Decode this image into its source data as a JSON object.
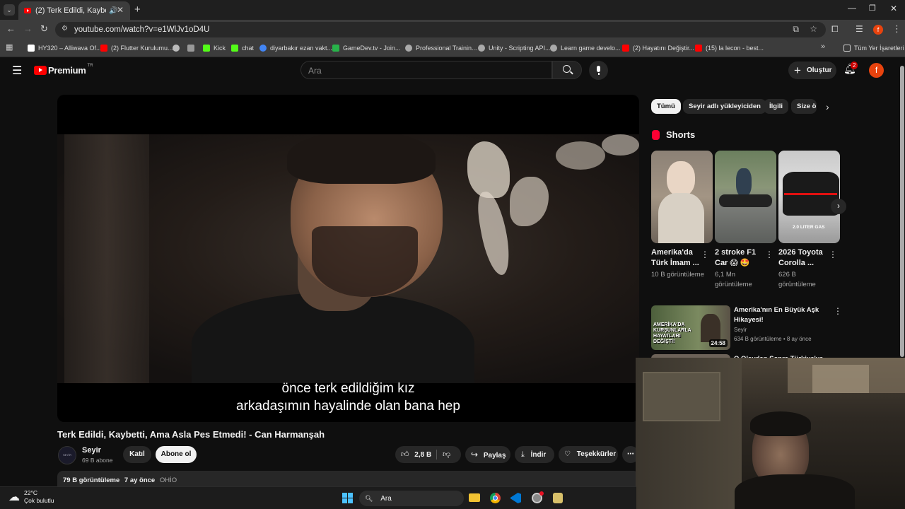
{
  "browser": {
    "tab_title": "(2) Terk Edildi, Kaybetti, Ama Asla Pes Etmedi! - Can Harmanşah",
    "tab_title_visible": "(2) Terk Edildi, Kaybetti, Am",
    "url": "youtube.com/watch?v=e1WlJv1oD4U",
    "profile_initial": "f",
    "bookmarks": [
      {
        "label": "HY320 – Alliwava Of...",
        "color": "#ffffff"
      },
      {
        "label": "(2) Flutter Kurulumu...",
        "color": "#ff0000"
      },
      {
        "label": "",
        "color": "#cccccc"
      },
      {
        "label": "",
        "color": "#cccccc"
      },
      {
        "label": "Kick",
        "color": "#53fc18"
      },
      {
        "label": "chat",
        "color": "#53fc18"
      },
      {
        "label": "diyarbakır ezan vakt...",
        "color": "#4285f4"
      },
      {
        "label": "GameDev.tv - Join...",
        "color": "#28b34a"
      },
      {
        "label": "Professional Trainin...",
        "color": "#cccccc"
      },
      {
        "label": "Unity - Scripting API...",
        "color": "#cccccc"
      },
      {
        "label": "Learn game develo...",
        "color": "#cccccc"
      },
      {
        "label": "(2) Hayatını Değiştir...",
        "color": "#ff0000"
      },
      {
        "label": "(15) la lecon - best...",
        "color": "#ff0000"
      }
    ],
    "bookmarks_all": "Tüm Yer İşaretleri"
  },
  "youtube": {
    "logo_text": "Premium",
    "logo_region": "TR",
    "search_placeholder": "Ara",
    "create_label": "Oluştur",
    "notif_count": "2",
    "avatar_initial": "f",
    "video": {
      "caption_line1": "önce terk edildiğim kız",
      "caption_line2": "arkadaşımın hayalinde olan bana hep",
      "title": "Terk Edildi, Kaybetti, Ama Asla Pes Etmedi! - Can Harmanşah",
      "channel": "Seyir",
      "subscribers": "69 B abone",
      "join": "Katıl",
      "subscribe": "Abone ol",
      "likes": "2,8 B",
      "share": "Paylaş",
      "download": "İndir",
      "thanks": "Teşekkürler",
      "views": "79 B görüntüleme",
      "age": "7 ay önce",
      "tag": "OHİO",
      "channel_avatar_text": "SEYİR"
    },
    "chips": [
      "Tümü",
      "Seyir adlı yükleyiciden",
      "İlgili",
      "Size ö"
    ],
    "shorts_heading": "Shorts",
    "shorts": [
      {
        "title": "Amerika'da Türk İmam ...",
        "views": "10 B görüntüleme"
      },
      {
        "title": "2 stroke F1 Car 😱 🤩",
        "views": "6,1 Mn görüntüleme"
      },
      {
        "title": "2026 Toyota Corolla ...",
        "views": "626 B görüntüleme",
        "thumb_text": "2.0 LITER GAS"
      }
    ],
    "recommendations": [
      {
        "title": "Amerika'nın En Büyük Aşk Hikayesi!",
        "channel": "Seyir",
        "meta": "634 B görüntüleme • 8 ay önce",
        "duration": "24:58",
        "thumb_text": "AMERİKA'DA KURŞUNLARLA HAYATLARI DEĞİŞTİ!"
      },
      {
        "title": "O Olaydan Sonra Türkiye'ye"
      }
    ]
  },
  "taskbar": {
    "temp": "22°C",
    "weather": "Çok bulutlu",
    "search": "Ara"
  }
}
